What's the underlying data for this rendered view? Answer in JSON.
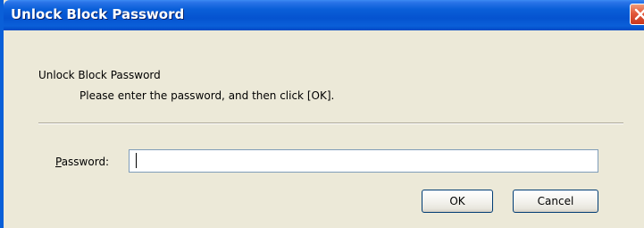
{
  "window": {
    "title": "Unlock Block Password"
  },
  "content": {
    "heading": "Unlock Block Password",
    "instruction": "Please enter the password, and then click [OK]."
  },
  "password_field": {
    "label_accel": "P",
    "label_rest": "assword:",
    "value": "",
    "placeholder": ""
  },
  "buttons": {
    "ok_label": "OK",
    "cancel_label": "Cancel"
  },
  "colors": {
    "titlebar_blue": "#0A5FD8",
    "dialog_background": "#ECE9D8",
    "close_red": "#E2583A"
  },
  "icons": {
    "close": "close-icon"
  }
}
